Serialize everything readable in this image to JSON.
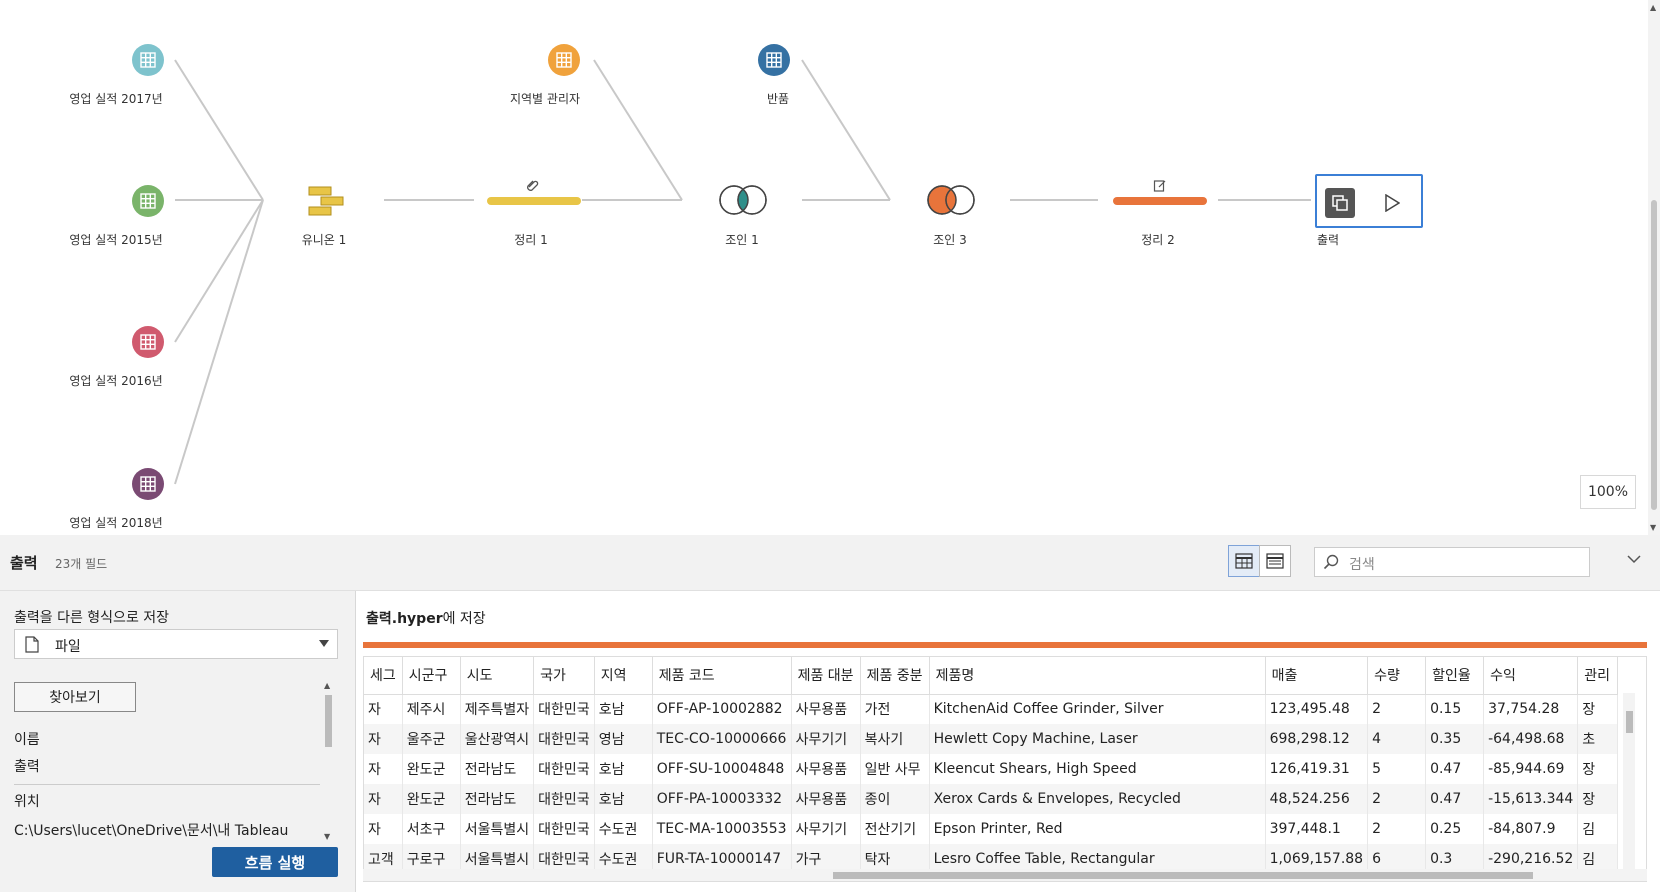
{
  "flow": {
    "nodes": {
      "sales2017": {
        "label": "영업 실적 2017년",
        "color": "#7ec3cd"
      },
      "sales2015": {
        "label": "영업 실적 2015년",
        "color": "#7ab46a"
      },
      "sales2016": {
        "label": "영업 실적 2016년",
        "color": "#d05a6e"
      },
      "sales2018": {
        "label": "영업 실적 2018년",
        "color": "#7a4a73"
      },
      "union1": {
        "label": "유니온 1",
        "color": "#e8c547"
      },
      "clean1": {
        "label": "정리 1",
        "color": "#e8c547"
      },
      "manager": {
        "label": "지역별 관리자",
        "color": "#f0a23c"
      },
      "join1": {
        "label": "조인 1",
        "color": "#2f8f8a"
      },
      "returns": {
        "label": "반품",
        "color": "#3571a3"
      },
      "join3": {
        "label": "조인 3",
        "color": "#e8743b"
      },
      "clean2": {
        "label": "정리 2",
        "color": "#e8743b"
      },
      "output": {
        "label": "출력"
      }
    },
    "zoom": "100%"
  },
  "panel": {
    "title": "출력",
    "field_count": "23개 필드",
    "search_placeholder": "검색"
  },
  "left": {
    "save_as_label": "출력을 다른 형식으로 저장",
    "format_value": "파일",
    "browse_label": "찾아보기",
    "name_label": "이름",
    "name_value": "출력",
    "location_label": "위치",
    "location_value": "C:\\Users\\lucet\\OneDrive\\문서\\내 Tableau",
    "run_label": "흐름 실행"
  },
  "right": {
    "save_file": "출력.hyper",
    "save_suffix": "에 저장",
    "columns": [
      "세그",
      "시군구",
      "시도",
      "국가",
      "지역",
      "제품 코드",
      "제품 대분",
      "제품 중분",
      "제품명",
      "매출",
      "수량",
      "할인율",
      "수익",
      "관리"
    ],
    "rows": [
      [
        "자",
        "제주시",
        "제주특별자",
        "대한민국",
        "호남",
        "OFF-AP-10002882",
        "사무용품",
        "가전",
        "KitchenAid Coffee Grinder, Silver",
        "123,495.48",
        "2",
        "0.15",
        "37,754.28",
        "장"
      ],
      [
        "자",
        "울주군",
        "울산광역시",
        "대한민국",
        "영남",
        "TEC-CO-10000666",
        "사무기기",
        "복사기",
        "Hewlett Copy Machine, Laser",
        "698,298.12",
        "4",
        "0.35",
        "-64,498.68",
        "초"
      ],
      [
        "자",
        "완도군",
        "전라남도",
        "대한민국",
        "호남",
        "OFF-SU-10004848",
        "사무용품",
        "일반 사무",
        "Kleencut Shears, High Speed",
        "126,419.31",
        "5",
        "0.47",
        "-85,944.69",
        "장"
      ],
      [
        "자",
        "완도군",
        "전라남도",
        "대한민국",
        "호남",
        "OFF-PA-10003332",
        "사무용품",
        "종이",
        "Xerox Cards & Envelopes, Recycled",
        "48,524.256",
        "2",
        "0.47",
        "-15,613.344",
        "장"
      ],
      [
        "자",
        "서초구",
        "서울특별시",
        "대한민국",
        "수도권",
        "TEC-MA-10003553",
        "사무기기",
        "전산기기",
        "Epson Printer, Red",
        "397,448.1",
        "2",
        "0.25",
        "-84,807.9",
        "김"
      ],
      [
        "고객",
        "구로구",
        "서울특별시",
        "대한민국",
        "수도권",
        "FUR-TA-10000147",
        "가구",
        "탁자",
        "Lesro Coffee Table, Rectangular",
        "1,069,157.88",
        "6",
        "0.3",
        "-290,216.52",
        "김"
      ]
    ]
  }
}
